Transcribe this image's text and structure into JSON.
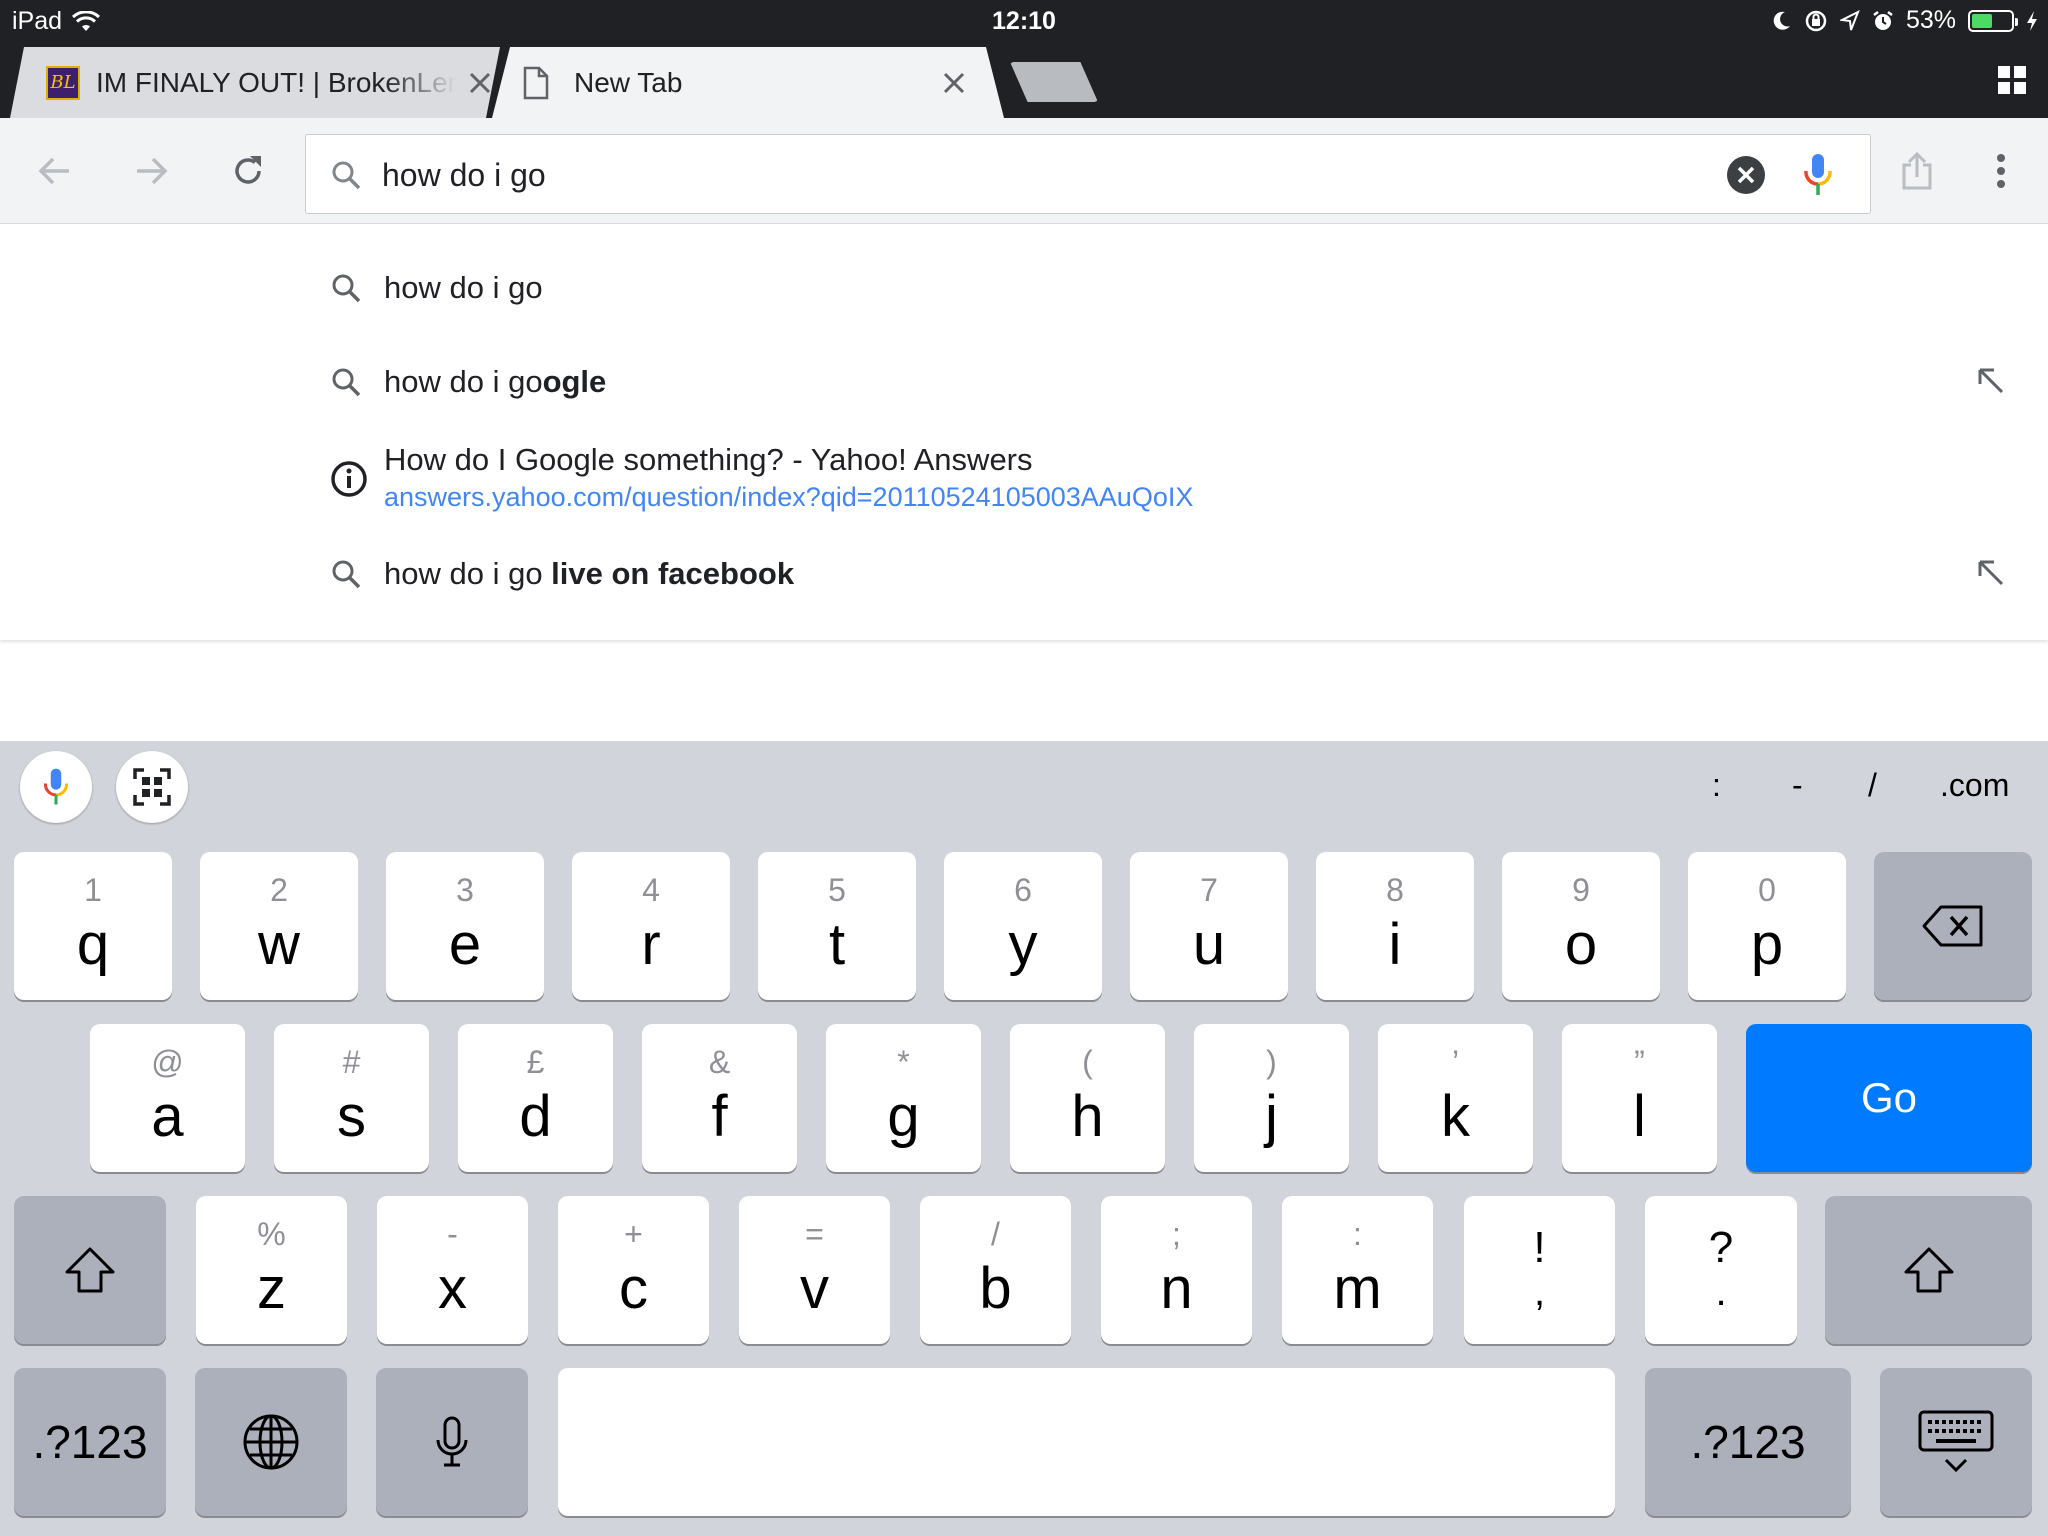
{
  "status_bar": {
    "device": "iPad",
    "time": "12:10",
    "battery_percent": "53%",
    "battery_level": 0.53
  },
  "tabs": [
    {
      "title": "IM FINALY OUT! | BrokenLens",
      "favicon": "BL",
      "active": false
    },
    {
      "title": "New Tab",
      "active": true
    }
  ],
  "omnibox": {
    "value": "how do i go",
    "placeholder": ""
  },
  "suggestions": [
    {
      "type": "search",
      "prefix": "how do i go",
      "bold": ""
    },
    {
      "type": "search",
      "prefix": "how do i go",
      "bold": "ogle"
    },
    {
      "type": "answer",
      "title": "How do I Google something? - Yahoo! Answers",
      "url": "answers.yahoo.com/question/index?qid=20110524105003AAuQoIX"
    },
    {
      "type": "search",
      "prefix": "how do i go ",
      "bold": "live on facebook"
    }
  ],
  "keyboard": {
    "shortcuts": [
      ":",
      "-",
      "/",
      ".com"
    ],
    "row1": [
      {
        "alt": "1",
        "main": "q"
      },
      {
        "alt": "2",
        "main": "w"
      },
      {
        "alt": "3",
        "main": "e"
      },
      {
        "alt": "4",
        "main": "r"
      },
      {
        "alt": "5",
        "main": "t"
      },
      {
        "alt": "6",
        "main": "y"
      },
      {
        "alt": "7",
        "main": "u"
      },
      {
        "alt": "8",
        "main": "i"
      },
      {
        "alt": "9",
        "main": "o"
      },
      {
        "alt": "0",
        "main": "p"
      }
    ],
    "row2": [
      {
        "alt": "@",
        "main": "a"
      },
      {
        "alt": "#",
        "main": "s"
      },
      {
        "alt": "£",
        "main": "d"
      },
      {
        "alt": "&",
        "main": "f"
      },
      {
        "alt": "*",
        "main": "g"
      },
      {
        "alt": "(",
        "main": "h"
      },
      {
        "alt": ")",
        "main": "j"
      },
      {
        "alt": "’",
        "main": "k"
      },
      {
        "alt": "”",
        "main": "l"
      }
    ],
    "row3": [
      {
        "alt": "%",
        "main": "z"
      },
      {
        "alt": "-",
        "main": "x"
      },
      {
        "alt": "+",
        "main": "c"
      },
      {
        "alt": "=",
        "main": "v"
      },
      {
        "alt": "/",
        "main": "b"
      },
      {
        "alt": ";",
        "main": "n"
      },
      {
        "alt": ":",
        "main": "m"
      }
    ],
    "punct": [
      {
        "top": "!",
        "bottom": ","
      },
      {
        "top": "?",
        "bottom": "."
      }
    ],
    "go_label": "Go",
    "numbers_label": ".?123",
    "go_color": "#007aff"
  },
  "icons": [
    "wifi-icon",
    "moon-icon",
    "rotation-lock-icon",
    "location-icon",
    "alarm-icon",
    "battery-icon",
    "charging-icon",
    "tab-switcher-icon",
    "back-arrow-icon",
    "forward-arrow-icon",
    "reload-icon",
    "search-icon",
    "clear-icon",
    "mic-icon",
    "share-icon",
    "menu-icon",
    "info-icon",
    "refine-arrow-icon",
    "qr-scanner-icon",
    "backspace-icon",
    "shift-icon",
    "globe-icon",
    "dictation-icon",
    "keyboard-dismiss-icon"
  ]
}
